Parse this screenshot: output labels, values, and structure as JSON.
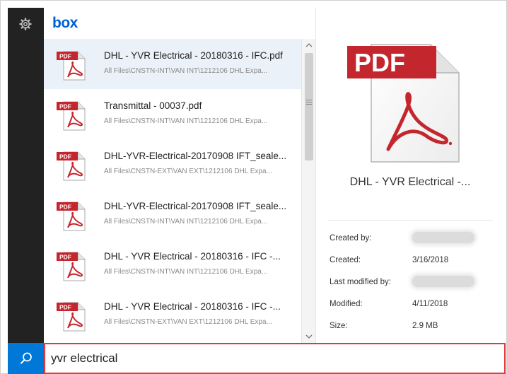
{
  "app": {
    "logo_text": "box"
  },
  "sidebar": {
    "settings_icon": "gear-icon"
  },
  "results": [
    {
      "name": "DHL - YVR Electrical - 20180316 - IFC.pdf",
      "path": "All Files\\CNSTN-INT\\VAN INT\\1212106 DHL Expa...",
      "selected": true
    },
    {
      "name": "Transmittal - 00037.pdf",
      "path": "All Files\\CNSTN-INT\\VAN INT\\1212106 DHL Expa...",
      "selected": false
    },
    {
      "name": "DHL-YVR-Electrical-20170908 IFT_seale...",
      "path": "All Files\\CNSTN-EXT\\VAN EXT\\1212106 DHL Expa...",
      "selected": false
    },
    {
      "name": "DHL-YVR-Electrical-20170908 IFT_seale...",
      "path": "All Files\\CNSTN-INT\\VAN INT\\1212106 DHL Expa...",
      "selected": false
    },
    {
      "name": "DHL - YVR Electrical - 20180316 - IFC -...",
      "path": "All Files\\CNSTN-INT\\VAN INT\\1212106 DHL Expa...",
      "selected": false
    },
    {
      "name": "DHL - YVR Electrical - 20180316 - IFC -...",
      "path": "All Files\\CNSTN-EXT\\VAN EXT\\1212106 DHL Expa...",
      "selected": false
    }
  ],
  "file_icon_label": "PDF",
  "preview": {
    "title": "DHL - YVR Electrical -...",
    "meta": {
      "created_by_label": "Created by:",
      "created_label": "Created:",
      "created_value": "3/16/2018",
      "last_modified_by_label": "Last modified by:",
      "modified_label": "Modified:",
      "modified_value": "4/11/2018",
      "size_label": "Size:",
      "size_value": "2.9 MB"
    }
  },
  "search": {
    "value": "yvr electrical"
  },
  "colors": {
    "accent": "#0078d7",
    "sidebar": "#222222",
    "pdf_red": "#c4262e",
    "input_border": "#e03a3a",
    "selected_row": "#eaf1f8",
    "logo": "#0061d5"
  }
}
